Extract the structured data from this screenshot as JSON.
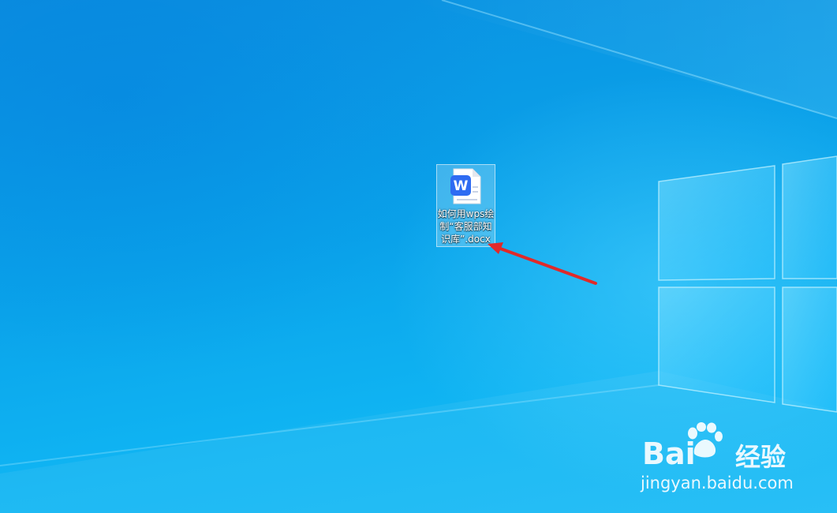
{
  "desktop": {
    "file": {
      "name": "如何用wps绘制“客服部知识库”.docx",
      "icon": "wps-writer-document-icon",
      "selected": true
    }
  },
  "watermark": {
    "brand_left": "Bai",
    "brand_right": "经验",
    "url": "jingyan.baidu.com"
  },
  "colors": {
    "desktop_blue": "#0aa3e8",
    "wps_blue": "#2f6cf2",
    "arrow_red": "#e02a2a"
  }
}
